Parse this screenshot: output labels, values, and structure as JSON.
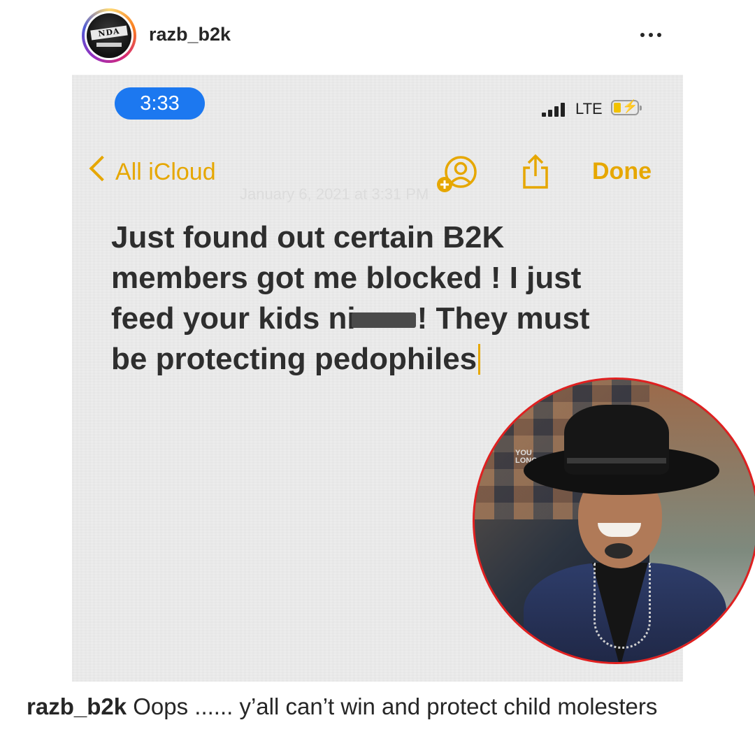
{
  "post": {
    "username": "razb_b2k",
    "avatar_text": "NDA",
    "more_icon": "more-horizontal-icon"
  },
  "phone_status": {
    "time": "3:33",
    "network": "LTE",
    "battery_color": "#f2c200",
    "time_pill_color": "#1c78f0"
  },
  "notes_toolbar": {
    "back_label": "All iCloud",
    "share_user_icon": "add-person-icon",
    "share_icon": "share-icon",
    "done_label": "Done",
    "accent_color": "#e6a700"
  },
  "note": {
    "faded_date": "January 6, 2021 at 3:31 PM",
    "line1": "Just found out certain B2K",
    "line2": "members got me blocked ! I just",
    "line3_before": "feed your kids ni",
    "line3_after": "! They must",
    "line4": "be protecting pedophiles"
  },
  "inset": {
    "border_color": "#e02020",
    "sign_text_1": "YOU",
    "sign_text_2": "LONG"
  },
  "caption": {
    "username": "razb_b2k",
    "text": " Oops ...... y’all can’t win and protect child molesters"
  }
}
